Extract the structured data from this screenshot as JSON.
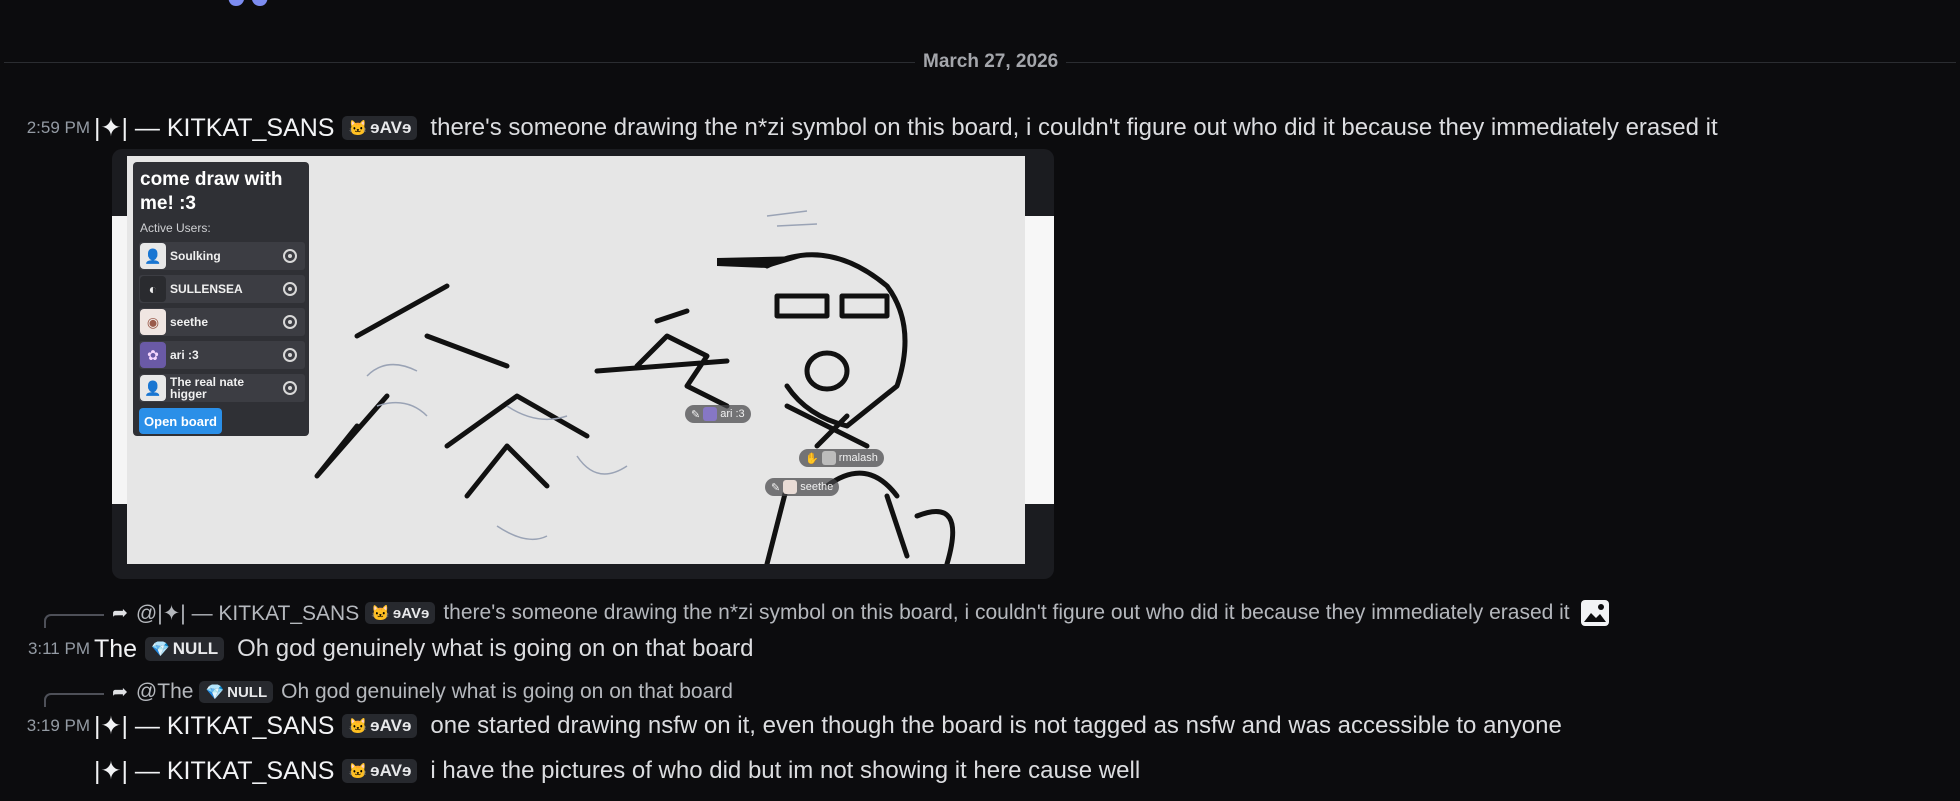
{
  "date_divider": "March 27, 2026",
  "colors": {
    "background": "#0c0c0e",
    "tag_bg": "#27292e",
    "open_board_button": "#2a8fe8"
  },
  "icons": {
    "top": "discord-blurple-icon",
    "reply": "reply-arrow-icon",
    "attachment": "image-attachment-icon",
    "guild_tag": "kitty-icon",
    "null_tag": "gem-icon"
  },
  "messages": [
    {
      "timestamp": "2:59 PM",
      "username": "|✦| — KITKAT_SANS",
      "tag": "ɘAVɘ",
      "content": "there's someone drawing the n*zi symbol on this board, i couldn't figure out who did it because they immediately erased it"
    },
    {
      "reply_to": {
        "mention": "@|✦| — KITKAT_SANS",
        "tag": "ɘAVɘ",
        "content": "there's someone drawing the n*zi symbol on this board, i couldn't figure out who did it because they immediately erased it"
      },
      "timestamp": "3:11 PM",
      "username": "The",
      "tag": "NULL",
      "content": "Oh god genuinely what is going on on that board"
    },
    {
      "reply_to": {
        "mention": "@The",
        "tag": "NULL",
        "content": "Oh god genuinely what is going on on that board"
      },
      "timestamp": "3:19 PM",
      "username": "|✦| — KITKAT_SANS",
      "tag": "ɘAVɘ",
      "content": "one started drawing nsfw on it, even though the board is not tagged as nsfw and was accessible to anyone"
    },
    {
      "username": "|✦| — KITKAT_SANS",
      "tag": "ɘAVɘ",
      "content": "i have the pictures of who did but im not showing it here cause well"
    }
  ],
  "embed": {
    "panel_title": "come draw with me! :3",
    "active_users_label": "Active Users:",
    "users": [
      {
        "name": "Soulking",
        "avatar": "person-icon"
      },
      {
        "name": "SULLENSEA",
        "avatar": "dark-avatar"
      },
      {
        "name": "seethe",
        "avatar": "pale-avatar"
      },
      {
        "name": "ari :3",
        "avatar": "purple-avatar"
      },
      {
        "name": "The real nate higger",
        "avatar": "person-icon"
      }
    ],
    "open_board_label": "Open board",
    "cursors": [
      "ari :3",
      "rmalash",
      "seethe"
    ]
  }
}
